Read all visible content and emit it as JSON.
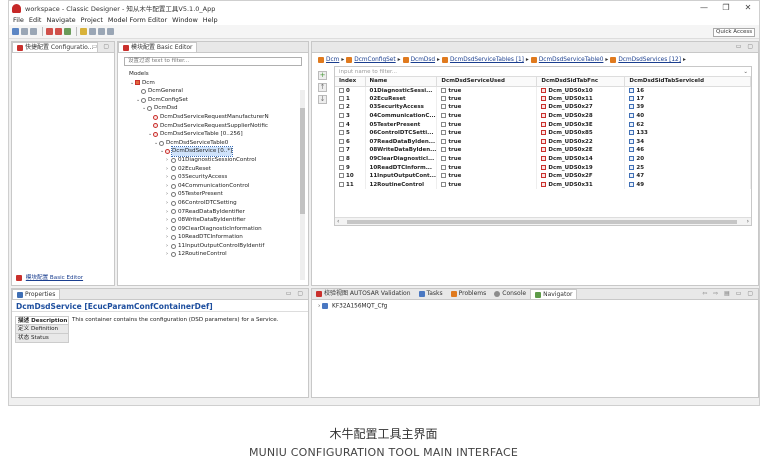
{
  "window": {
    "title": "workspace - Classic Designer - 知从木牛配置工具V5.1.0_App",
    "controls": [
      "—",
      "❐",
      "✕"
    ]
  },
  "menu": [
    "File",
    "Edit",
    "Navigate",
    "Project",
    "Model Form Editor",
    "Window",
    "Help"
  ],
  "toolbar": {
    "quick_access": "Quick Access"
  },
  "left_panel": {
    "tabs": [
      "快捷配置 Configuratio...",
      "模块配置 Basic Editor"
    ],
    "bottom_link": "模块配置 Basic Editor"
  },
  "model_panel": {
    "tab": "模块配置 Basic Editor",
    "filter_placeholder": "设置过滤 text to filter...",
    "tree": [
      {
        "label": "Models",
        "indent": 0,
        "arrow": "",
        "icon": "none"
      },
      {
        "label": "Dcm",
        "indent": 1,
        "arrow": "⌄",
        "icon": "pkg"
      },
      {
        "label": "DcmGeneral",
        "indent": 2,
        "arrow": "",
        "icon": "gray"
      },
      {
        "label": "DcmConfigSet",
        "indent": 2,
        "arrow": "⌄",
        "icon": "gray"
      },
      {
        "label": "DcmDsd",
        "indent": 3,
        "arrow": "⌄",
        "icon": "gray"
      },
      {
        "label": "DcmDsdServiceRequestManufacturerN",
        "indent": 4,
        "arrow": "",
        "icon": "red"
      },
      {
        "label": "DcmDsdServiceRequestSupplierNotific",
        "indent": 4,
        "arrow": "",
        "icon": "red"
      },
      {
        "label": "DcmDsdServiceTable [0..256]",
        "indent": 4,
        "arrow": "⌄",
        "icon": "red"
      },
      {
        "label": "DcmDsdServiceTable0",
        "indent": 5,
        "arrow": "⌄",
        "icon": "gray"
      },
      {
        "label": "DcmDsdService [0..*]",
        "indent": 6,
        "arrow": "⌄",
        "icon": "red",
        "selected": true
      },
      {
        "label": "01DiagnosticSessionControl",
        "indent": 7,
        "arrow": "›",
        "icon": "gray"
      },
      {
        "label": "02EcuReset",
        "indent": 7,
        "arrow": "›",
        "icon": "gray"
      },
      {
        "label": "03SecurityAccess",
        "indent": 7,
        "arrow": "›",
        "icon": "gray"
      },
      {
        "label": "04CommunicationControl",
        "indent": 7,
        "arrow": "›",
        "icon": "gray"
      },
      {
        "label": "05TesterPresent",
        "indent": 7,
        "arrow": "›",
        "icon": "gray"
      },
      {
        "label": "06ControlDTCSetting",
        "indent": 7,
        "arrow": "›",
        "icon": "gray"
      },
      {
        "label": "07ReadDataByIdentifier",
        "indent": 7,
        "arrow": "›",
        "icon": "gray"
      },
      {
        "label": "08WriteDataByIdentifier",
        "indent": 7,
        "arrow": "›",
        "icon": "gray"
      },
      {
        "label": "09ClearDiagnosticInformation",
        "indent": 7,
        "arrow": "›",
        "icon": "gray"
      },
      {
        "label": "10ReadDTCInformation",
        "indent": 7,
        "arrow": "›",
        "icon": "gray"
      },
      {
        "label": "11InputOutputControlByIdentif",
        "indent": 7,
        "arrow": "›",
        "icon": "gray"
      },
      {
        "label": "12RoutineControl",
        "indent": 7,
        "arrow": "›",
        "icon": "gray"
      }
    ]
  },
  "editor": {
    "breadcrumb": [
      "Dcm",
      "DcmConfigSet",
      "DcmDsd",
      "DcmDsdServiceTables [1]",
      "DcmDsdServiceTable0",
      "DcmDsdServices [12]"
    ],
    "search_placeholder": "input name to filter...",
    "columns": [
      "Index",
      "Name",
      "DcmDsdServiceUsed",
      "DcmDsdSidTabFnc",
      "DcmDsdSidTabServiceId"
    ],
    "rows": [
      {
        "index": "0",
        "name": "01DiagnosticSessi...",
        "used": "true",
        "fnc": "Dcm_UDS0x10",
        "sid": "16"
      },
      {
        "index": "1",
        "name": "02EcuReset",
        "used": "true",
        "fnc": "Dcm_UDS0x11",
        "sid": "17"
      },
      {
        "index": "2",
        "name": "03SecurityAccess",
        "used": "true",
        "fnc": "Dcm_UDS0x27",
        "sid": "39"
      },
      {
        "index": "3",
        "name": "04CommunicationC...",
        "used": "true",
        "fnc": "Dcm_UDS0x28",
        "sid": "40"
      },
      {
        "index": "4",
        "name": "05TesterPresent",
        "used": "true",
        "fnc": "Dcm_UDS0x3E",
        "sid": "62"
      },
      {
        "index": "5",
        "name": "06ControlDTCSetti...",
        "used": "true",
        "fnc": "Dcm_UDS0x85",
        "sid": "133"
      },
      {
        "index": "6",
        "name": "07ReadDataByIden...",
        "used": "true",
        "fnc": "Dcm_UDS0x22",
        "sid": "34"
      },
      {
        "index": "7",
        "name": "08WriteDataByIden...",
        "used": "true",
        "fnc": "Dcm_UDS0x2E",
        "sid": "46"
      },
      {
        "index": "8",
        "name": "09ClearDiagnosticl...",
        "used": "true",
        "fnc": "Dcm_UDS0x14",
        "sid": "20"
      },
      {
        "index": "9",
        "name": "10ReadDTCInform...",
        "used": "true",
        "fnc": "Dcm_UDS0x19",
        "sid": "25"
      },
      {
        "index": "10",
        "name": "11InputOutputCont...",
        "used": "true",
        "fnc": "Dcm_UDS0x2F",
        "sid": "47"
      },
      {
        "index": "11",
        "name": "12RoutineControl",
        "used": "true",
        "fnc": "Dcm_UDS0x31",
        "sid": "49"
      }
    ]
  },
  "properties": {
    "tab": "Properties",
    "heading": "DcmDsdService [EcucParamConfContainerDef]",
    "side_tabs": [
      "描述 Description",
      "定义 Definition",
      "状态 Status"
    ],
    "description": "This container contains the configuration (DSD parameters) for a Service."
  },
  "bottom_tabs": {
    "tabs": [
      "校验视图 AUTOSAR Validation",
      "Tasks",
      "Problems",
      "Console",
      "Navigator"
    ],
    "navigator_item": "KF32A156MQT_Cfg"
  },
  "caption": {
    "zh": "木牛配置工具主界面",
    "en": "MUNIU CONFIGURATION TOOL MAIN INTERFACE"
  }
}
